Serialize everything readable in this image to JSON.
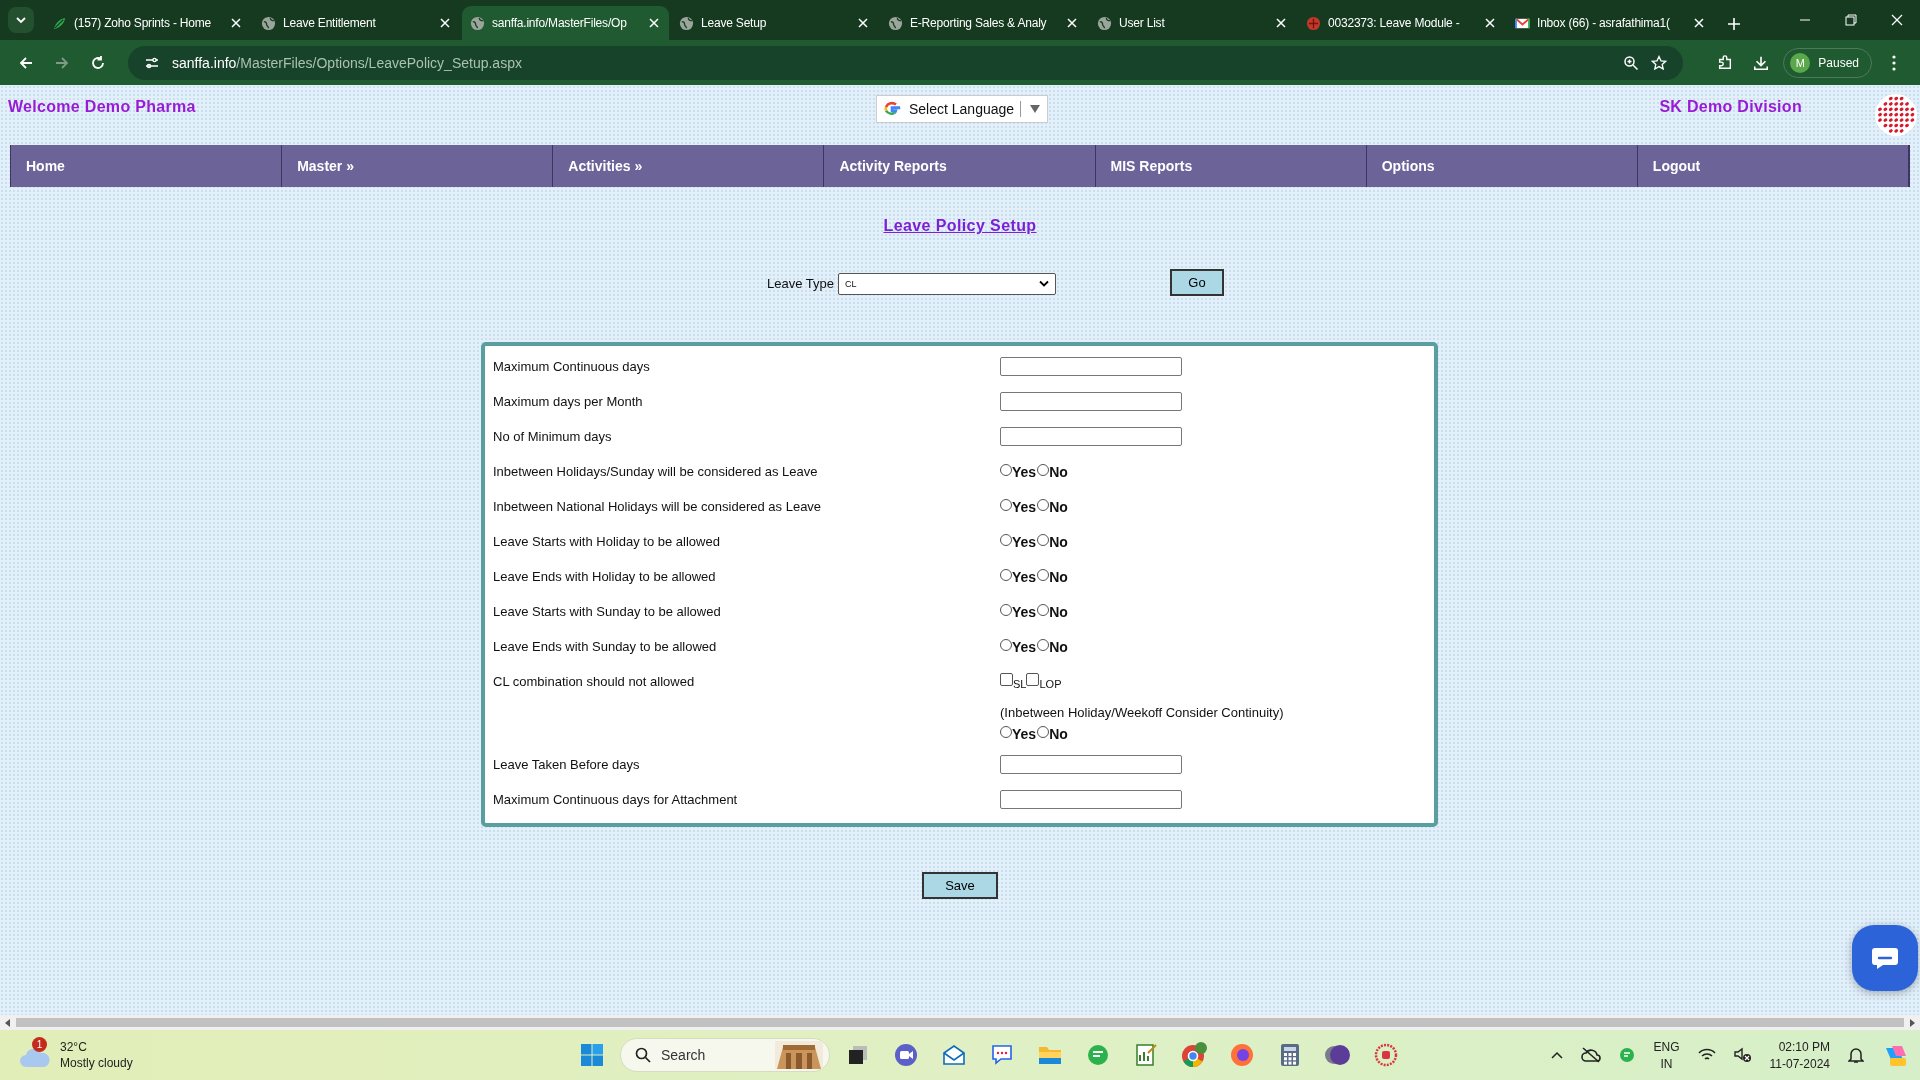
{
  "browser": {
    "tabs": [
      {
        "title": "(157) Zoho Sprints - Home",
        "kind": "leaf",
        "selected": false
      },
      {
        "title": "Leave Entitlement",
        "kind": "globe",
        "selected": false
      },
      {
        "title": "sanffa.info/MasterFiles/Op",
        "kind": "globe",
        "selected": true
      },
      {
        "title": "Leave Setup",
        "kind": "globe",
        "selected": false
      },
      {
        "title": "E-Reporting Sales & Analy",
        "kind": "globe",
        "selected": false
      },
      {
        "title": "User List",
        "kind": "globe",
        "selected": false
      },
      {
        "title": "0032373: Leave Module -",
        "kind": "dots",
        "selected": false
      },
      {
        "title": "Inbox (66) - asrafathima1(",
        "kind": "mail",
        "selected": false
      }
    ],
    "address": {
      "domain": "sanffa.info",
      "path": "/MasterFiles/Options/LeavePolicy_Setup.aspx"
    },
    "profile": {
      "initial": "M",
      "status": "Paused"
    }
  },
  "header": {
    "welcome": "Welcome Demo Pharma",
    "language": "Select Language",
    "division": "SK Demo Division"
  },
  "nav": [
    "Home",
    "Master »",
    "Activities »",
    "Activity Reports",
    "MIS Reports",
    "Options",
    "Logout"
  ],
  "title": "Leave Policy Setup",
  "leave_type": {
    "label": "Leave Type",
    "value": "CL",
    "button": "Go"
  },
  "rows": [
    {
      "kind": "text",
      "label": "Maximum Continuous days"
    },
    {
      "kind": "text",
      "label": "Maximum days per Month"
    },
    {
      "kind": "text",
      "label": "No of Minimum days"
    },
    {
      "kind": "radio",
      "label": "Inbetween Holidays/Sunday will be considered as Leave",
      "options": [
        {
          "label": "Yes",
          "selected": false
        },
        {
          "label": "No",
          "selected": false
        }
      ]
    },
    {
      "kind": "radio",
      "label": "Inbetween National Holidays will be considered as Leave",
      "options": [
        {
          "label": "Yes",
          "selected": false
        },
        {
          "label": "No",
          "selected": false
        }
      ]
    },
    {
      "kind": "radio",
      "label": "Leave Starts with Holiday to be allowed",
      "options": [
        {
          "label": "Yes",
          "selected": false
        },
        {
          "label": "No",
          "selected": false
        }
      ]
    },
    {
      "kind": "radio",
      "label": "Leave Ends with Holiday to be allowed",
      "options": [
        {
          "label": "Yes",
          "selected": false
        },
        {
          "label": "No",
          "selected": false
        }
      ]
    },
    {
      "kind": "radio",
      "label": "Leave Starts with Sunday to be allowed",
      "options": [
        {
          "label": "Yes",
          "selected": false
        },
        {
          "label": "No",
          "selected": false
        }
      ]
    },
    {
      "kind": "radio",
      "label": "Leave Ends with Sunday to be allowed",
      "options": [
        {
          "label": "Yes",
          "selected": false
        },
        {
          "label": "No",
          "selected": false
        }
      ]
    },
    {
      "kind": "checkbox",
      "label": "CL combination should not allowed",
      "options": [
        {
          "label": "SL",
          "checked": false
        },
        {
          "label": "LOP",
          "checked": false
        }
      ]
    },
    {
      "kind": "note_radio",
      "note": "(Inbetween Holiday/Weekoff Consider Continuity)",
      "options": [
        {
          "label": "Yes",
          "selected": false
        },
        {
          "label": "No",
          "selected": false
        }
      ]
    },
    {
      "kind": "text",
      "label": "Leave Taken Before days"
    },
    {
      "kind": "text",
      "label": "Maximum Continuous days for Attachment"
    }
  ],
  "save": "Save",
  "taskbar": {
    "weather": {
      "badge": "1",
      "temp": "32°C",
      "condition": "Mostly cloudy"
    },
    "search": "Search",
    "language": [
      "ENG",
      "IN"
    ],
    "time": "02:10 PM",
    "date": "11-07-2024"
  }
}
